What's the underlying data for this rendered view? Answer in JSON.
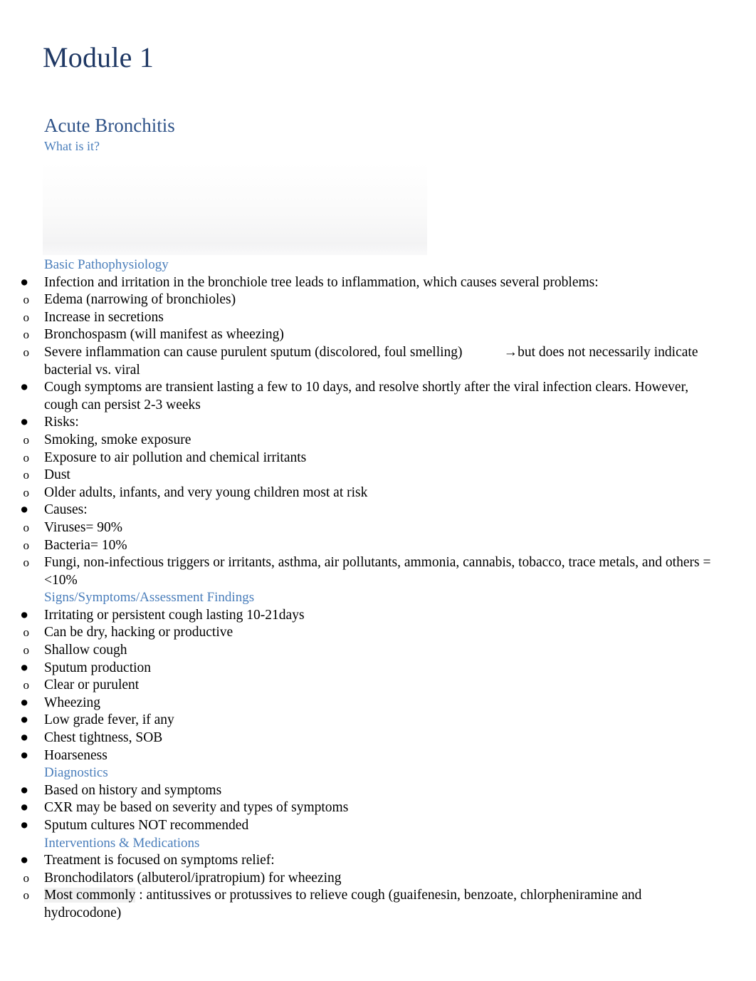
{
  "document": {
    "title": "Module 1",
    "section_title": "Acute Bronchitis",
    "subsection_title": "What is it?",
    "colors": {
      "title": "#1F3864",
      "section": "#2E5288",
      "subsection": "#4A7EBB",
      "heading": "#4A7EBB",
      "body": "#000000",
      "page_background": "#FFFFFF"
    }
  },
  "markers": {
    "bullet": "●",
    "sub": "o",
    "arrow": "→"
  },
  "sections": [
    {
      "heading": "Basic Pathophysiology",
      "items": [
        {
          "level": 1,
          "text": "Infection and irritation in the bronchiole tree leads to inflammation, which causes several problems:"
        },
        {
          "level": 2,
          "text": "Edema (narrowing of bronchioles)"
        },
        {
          "level": 2,
          "text": "Increase in secretions"
        },
        {
          "level": 2,
          "text": "Bronchospasm (will manifest as wheezing)"
        },
        {
          "level": 2,
          "text": "Severe inflammation can cause purulent sputum (discolored, foul smelling)",
          "tab_after": true,
          "text2": "→but does not necessarily indicate bacterial vs. viral"
        },
        {
          "level": 1,
          "text": "Cough symptoms are transient lasting a few to 10 days, and resolve shortly after the viral infection clears. However, cough can persist 2-3 weeks"
        },
        {
          "level": 1,
          "text": "Risks:"
        },
        {
          "level": 2,
          "text": "Smoking, smoke exposure"
        },
        {
          "level": 2,
          "text": "Exposure to air pollution and chemical irritants"
        },
        {
          "level": 2,
          "text": "Dust"
        },
        {
          "level": 2,
          "text": "Older adults, infants, and very young children most at risk"
        },
        {
          "level": 1,
          "text": "Causes:"
        },
        {
          "level": 2,
          "text": "Viruses= 90%"
        },
        {
          "level": 2,
          "text": "Bacteria= 10%"
        },
        {
          "level": 2,
          "text": "Fungi, non-infectious triggers or irritants, asthma, air pollutants, ammonia, cannabis, tobacco, trace metals, and others = <10%"
        }
      ]
    },
    {
      "heading": "Signs/Symptoms/Assessment Findings",
      "items": [
        {
          "level": 1,
          "text": "Irritating or persistent cough lasting 10-21days"
        },
        {
          "level": 2,
          "text": "Can be dry, hacking or productive"
        },
        {
          "level": 2,
          "text": "Shallow cough"
        },
        {
          "level": 1,
          "text": "Sputum production"
        },
        {
          "level": 2,
          "text": "Clear or purulent"
        },
        {
          "level": 1,
          "text": "Wheezing"
        },
        {
          "level": 1,
          "text": "Low grade fever, if any"
        },
        {
          "level": 1,
          "text": "Chest tightness, SOB"
        },
        {
          "level": 1,
          "text": "Hoarseness"
        }
      ]
    },
    {
      "heading": "Diagnostics",
      "items": [
        {
          "level": 1,
          "text": "Based on history and symptoms"
        },
        {
          "level": 1,
          "text": "CXR may be based on severity and types of symptoms"
        },
        {
          "level": 1,
          "text": "Sputum cultures NOT recommended"
        }
      ]
    },
    {
      "heading": "Interventions & Medications",
      "items": [
        {
          "level": 1,
          "text": "Treatment is focused on symptoms relief:"
        },
        {
          "level": 2,
          "text": "Bronchodilators (albuterol/ipratropium) for wheezing"
        },
        {
          "level": 2,
          "highlight": "Most commonly",
          "text": " : antitussives or protussives to relieve cough (guaifenesin, benzoate, chlorpheniramine and hydrocodone)"
        }
      ]
    }
  ]
}
